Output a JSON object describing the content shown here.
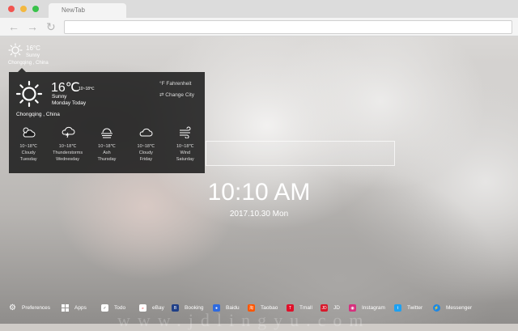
{
  "browser": {
    "tab_title": "NewTab",
    "back_icon": "arrow-left-icon",
    "forward_icon": "arrow-right-icon",
    "reload_icon": "reload-icon",
    "url": ""
  },
  "mini_weather": {
    "icon": "sun-icon",
    "temp": "16°C",
    "desc": "Sunny",
    "location": "Chongqing , China"
  },
  "weather_panel": {
    "icon": "sun-icon",
    "temp": "16℃",
    "range": "10~18℃",
    "desc": "Sunny",
    "day": "Monday Today",
    "location": "Chongqing , China",
    "fahrenheit_label": "Fahrenheit",
    "change_city_label": "Change City",
    "forecast": [
      {
        "icon": "cloudy-sun-icon",
        "range": "10~18℃",
        "desc": "Cloudy",
        "day": "Tuesday"
      },
      {
        "icon": "thunderstorm-icon",
        "range": "10~18℃",
        "desc": "Thunderstorms",
        "day": "Wednesday"
      },
      {
        "icon": "ash-icon",
        "range": "10~18℃",
        "desc": "Ash",
        "day": "Thursday"
      },
      {
        "icon": "cloud-icon",
        "range": "10~18℃",
        "desc": "Cloudy",
        "day": "Friday"
      },
      {
        "icon": "wind-icon",
        "range": "10~18℃",
        "desc": "Wind",
        "day": "Saturday"
      }
    ]
  },
  "clock": {
    "time": "10:10 AM",
    "date": "2017.10.30 Mon"
  },
  "dock": {
    "items": [
      {
        "label": "Preferences",
        "icon": "gear-icon",
        "color": "#ffffff"
      },
      {
        "label": "Apps",
        "icon": "grid-icon",
        "color": "#ffffff"
      },
      {
        "label": "Todo",
        "icon": "checkbox-icon",
        "color": "#ffffff"
      },
      {
        "label": "eBay",
        "icon": "ebay-icon",
        "color": "#ffffff"
      },
      {
        "label": "Booking",
        "icon": "booking-icon",
        "color": "#1f3f87"
      },
      {
        "label": "Baidu",
        "icon": "baidu-icon",
        "color": "#2f6be0"
      },
      {
        "label": "Taobao",
        "icon": "taobao-icon",
        "color": "#ff5500"
      },
      {
        "label": "Tmall",
        "icon": "tmall-icon",
        "color": "#e0102a"
      },
      {
        "label": "JD",
        "icon": "jd-icon",
        "color": "#d8192b"
      },
      {
        "label": "Instagram",
        "icon": "instagram-icon",
        "color": "#d6317e"
      },
      {
        "label": "Twitter",
        "icon": "twitter-icon",
        "color": "#1da1f2"
      },
      {
        "label": "Messenger",
        "icon": "messenger-icon",
        "color": "#1e88e5"
      }
    ]
  },
  "watermark": "www.jdlingyu.com"
}
